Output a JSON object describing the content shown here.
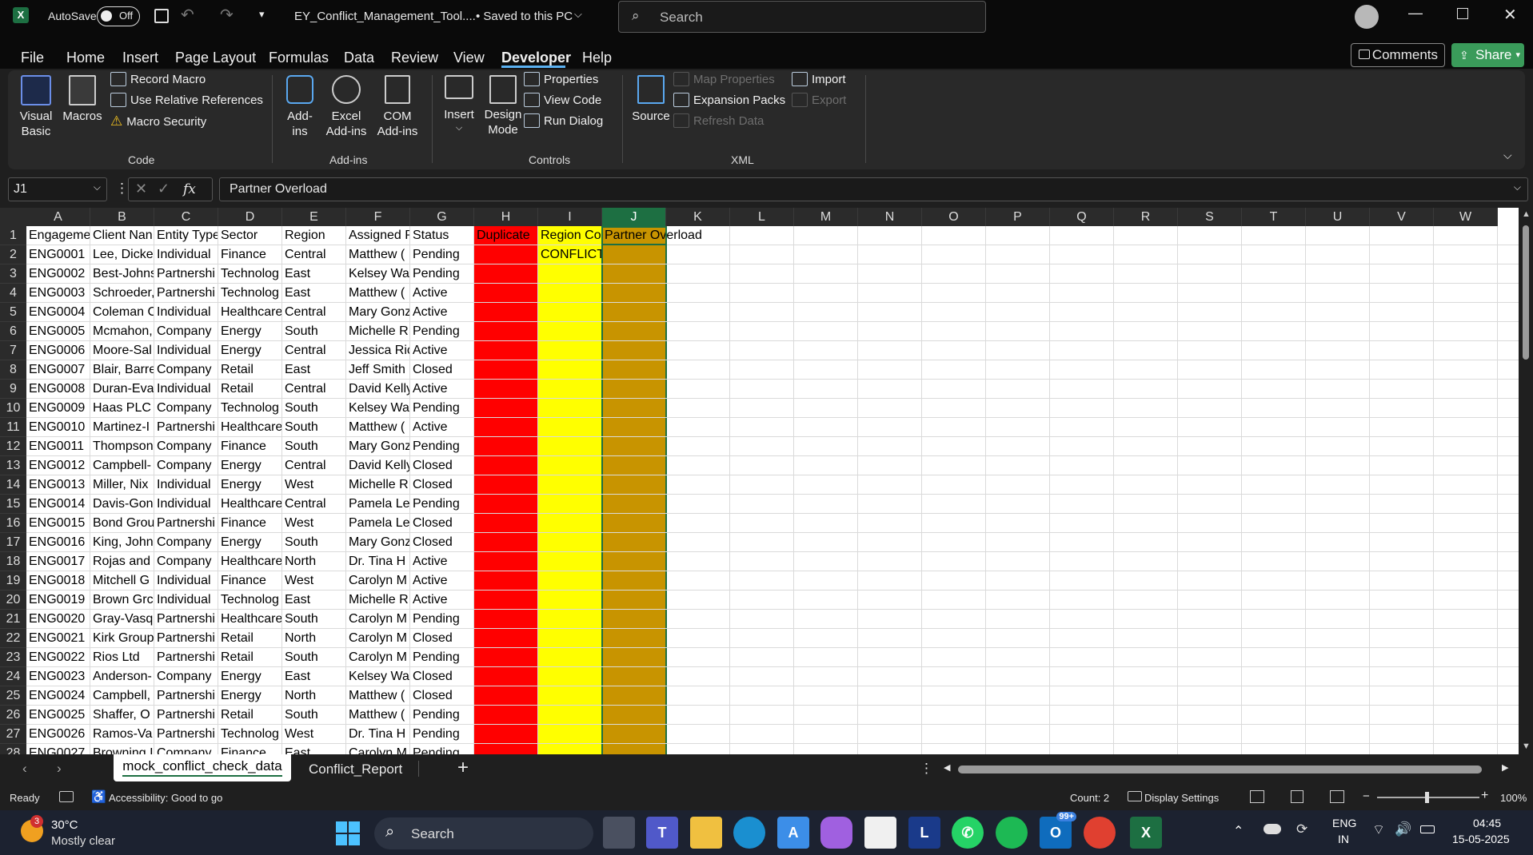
{
  "titlebar": {
    "app_icon": "excel-icon",
    "autosave_label": "AutoSave",
    "autosave_state": "Off",
    "filename": "EY_Conflict_Management_Tool....",
    "save_status": "• Saved to this PC",
    "search_placeholder": "Search"
  },
  "menu": [
    "File",
    "Home",
    "Insert",
    "Page Layout",
    "Formulas",
    "Data",
    "Review",
    "View",
    "Developer",
    "Help"
  ],
  "menu_active": "Developer",
  "comments_label": "Comments",
  "share_label": "Share",
  "ribbon": {
    "code": {
      "label": "Code",
      "visual_basic": "Visual Basic",
      "macros": "Macros",
      "record_macro": "Record Macro",
      "relative_refs": "Use Relative References",
      "macro_security": "Macro Security"
    },
    "addins": {
      "label": "Add-ins",
      "addins": "Add-ins",
      "excel_addins": "Excel Add-ins",
      "com_addins": "COM Add-ins"
    },
    "controls": {
      "label": "Controls",
      "insert": "Insert",
      "design_mode": "Design Mode",
      "properties": "Properties",
      "view_code": "View Code",
      "run_dialog": "Run Dialog"
    },
    "xml": {
      "label": "XML",
      "source": "Source",
      "map_properties": "Map Properties",
      "expansion_packs": "Expansion Packs",
      "refresh_data": "Refresh Data",
      "import": "Import",
      "export": "Export"
    }
  },
  "formula": {
    "name_box": "J1",
    "fx": "fx",
    "content": "Partner Overload"
  },
  "columns": [
    "A",
    "B",
    "C",
    "D",
    "E",
    "F",
    "G",
    "H",
    "I",
    "J",
    "K",
    "L",
    "M",
    "N",
    "O",
    "P",
    "Q",
    "R",
    "S",
    "T",
    "U",
    "V",
    "W"
  ],
  "rows": [
    [
      "Engageme",
      "Client Nan",
      "Entity Type",
      "Sector",
      "Region",
      "Assigned P",
      "Status",
      "Duplicate",
      "Region Co",
      "Partner Overload"
    ],
    [
      "ENG0001",
      "Lee, Dicke",
      "Individual",
      "Finance",
      "Central",
      "Matthew (",
      "Pending",
      "",
      "CONFLICT",
      ""
    ],
    [
      "ENG0002",
      "Best-Johns",
      "Partnershi",
      "Technolog",
      "East",
      "Kelsey Wa",
      "Pending",
      "",
      "",
      ""
    ],
    [
      "ENG0003",
      "Schroeder,",
      "Partnershi",
      "Technolog",
      "East",
      "Matthew (",
      "Active",
      "",
      "",
      ""
    ],
    [
      "ENG0004",
      "Coleman C",
      "Individual",
      "Healthcare",
      "Central",
      "Mary Gonz",
      "Active",
      "",
      "",
      ""
    ],
    [
      "ENG0005",
      "Mcmahon,",
      "Company",
      "Energy",
      "South",
      "Michelle R",
      "Pending",
      "",
      "",
      ""
    ],
    [
      "ENG0006",
      "Moore-Sal",
      "Individual",
      "Energy",
      "Central",
      "Jessica Ric",
      "Active",
      "",
      "",
      ""
    ],
    [
      "ENG0007",
      "Blair, Barre",
      "Company",
      "Retail",
      "East",
      "Jeff Smith",
      "Closed",
      "",
      "",
      ""
    ],
    [
      "ENG0008",
      "Duran-Eva",
      "Individual",
      "Retail",
      "Central",
      "David Kelly",
      "Active",
      "",
      "",
      ""
    ],
    [
      "ENG0009",
      "Haas PLC",
      "Company",
      "Technolog",
      "South",
      "Kelsey Wa",
      "Pending",
      "",
      "",
      ""
    ],
    [
      "ENG0010",
      "Martinez-I",
      "Partnershi",
      "Healthcare",
      "South",
      "Matthew (",
      "Active",
      "",
      "",
      ""
    ],
    [
      "ENG0011",
      "Thompson",
      "Company",
      "Finance",
      "South",
      "Mary Gonz",
      "Pending",
      "",
      "",
      ""
    ],
    [
      "ENG0012",
      "Campbell-",
      "Company",
      "Energy",
      "Central",
      "David Kelly",
      "Closed",
      "",
      "",
      ""
    ],
    [
      "ENG0013",
      "Miller, Nix",
      "Individual",
      "Energy",
      "West",
      "Michelle R",
      "Closed",
      "",
      "",
      ""
    ],
    [
      "ENG0014",
      "Davis-Gon",
      "Individual",
      "Healthcare",
      "Central",
      "Pamela Le",
      "Pending",
      "",
      "",
      ""
    ],
    [
      "ENG0015",
      "Bond Grou",
      "Partnershi",
      "Finance",
      "West",
      "Pamela Le",
      "Closed",
      "",
      "",
      ""
    ],
    [
      "ENG0016",
      "King, Johns",
      "Company",
      "Energy",
      "South",
      "Mary Gonz",
      "Closed",
      "",
      "",
      ""
    ],
    [
      "ENG0017",
      "Rojas and",
      "Company",
      "Healthcare",
      "North",
      "Dr. Tina H",
      "Active",
      "",
      "",
      ""
    ],
    [
      "ENG0018",
      "Mitchell G",
      "Individual",
      "Finance",
      "West",
      "Carolyn M",
      "Active",
      "",
      "",
      ""
    ],
    [
      "ENG0019",
      "Brown Grc",
      "Individual",
      "Technolog",
      "East",
      "Michelle R",
      "Active",
      "",
      "",
      ""
    ],
    [
      "ENG0020",
      "Gray-Vasq",
      "Partnershi",
      "Healthcare",
      "South",
      "Carolyn M",
      "Pending",
      "",
      "",
      ""
    ],
    [
      "ENG0021",
      "Kirk Group",
      "Partnershi",
      "Retail",
      "North",
      "Carolyn M",
      "Closed",
      "",
      "",
      ""
    ],
    [
      "ENG0022",
      "Rios Ltd",
      "Partnershi",
      "Retail",
      "South",
      "Carolyn M",
      "Pending",
      "",
      "",
      ""
    ],
    [
      "ENG0023",
      "Anderson-",
      "Company",
      "Energy",
      "East",
      "Kelsey Wa",
      "Closed",
      "",
      "",
      ""
    ],
    [
      "ENG0024",
      "Campbell,",
      "Partnershi",
      "Energy",
      "North",
      "Matthew (",
      "Closed",
      "",
      "",
      ""
    ],
    [
      "ENG0025",
      "Shaffer, O",
      "Partnershi",
      "Retail",
      "South",
      "Matthew (",
      "Pending",
      "",
      "",
      ""
    ],
    [
      "ENG0026",
      "Ramos-Va",
      "Partnershi",
      "Technolog",
      "West",
      "Dr. Tina H",
      "Pending",
      "",
      "",
      ""
    ],
    [
      "ENG0027",
      "Browning I",
      "Company",
      "Finance",
      "East",
      "Carolyn M",
      "Pending",
      "",
      "",
      ""
    ]
  ],
  "fill_colors": {
    "H": "#ff0000",
    "I": "#ffff00",
    "J": "#c89400"
  },
  "sheets": [
    "mock_conflict_check_data",
    "Conflict_Report"
  ],
  "active_sheet": "mock_conflict_check_data",
  "status": {
    "ready": "Ready",
    "accessibility": "Accessibility: Good to go",
    "count": "Count: 2",
    "display_settings": "Display Settings",
    "zoom": "100%"
  },
  "taskbar": {
    "weather_temp": "30°C",
    "weather_desc": "Mostly clear",
    "weather_badge": "3",
    "search": "Search",
    "badge_99": "99+",
    "lang": "ENG",
    "region": "IN",
    "time": "04:45",
    "date": "15-05-2025"
  }
}
